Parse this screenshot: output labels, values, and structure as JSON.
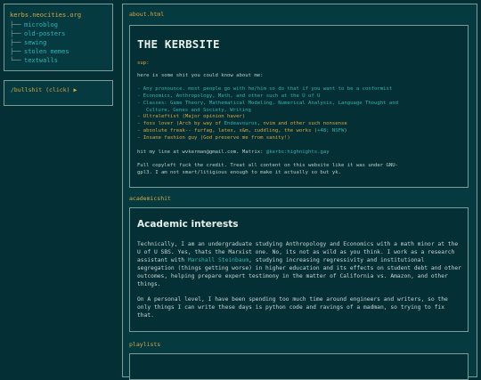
{
  "sidebar": {
    "site_title": "kerbs.neocities.org",
    "tree_branch": "├──",
    "tree_last": "└──",
    "items": [
      {
        "label": "microblog"
      },
      {
        "label": "old-posters"
      },
      {
        "label": "sewing"
      },
      {
        "label": "stolen memes"
      },
      {
        "label": "textwalls"
      }
    ],
    "bullshit_link": "/bullshit (click) ▶"
  },
  "about": {
    "section_label": "about.html",
    "title": "THE KERBSITE",
    "greeting": "sup:",
    "intro": "here is some shit you could know about me:",
    "list": [
      {
        "text": "- Any pronounce. most people go with he/him so do that if you want to be a conformist",
        "color": "teal"
      },
      {
        "text": "- Economics, Anthropology, Math, and other such at the U of U",
        "color": "teal"
      },
      {
        "text": "- Classes: Game Theory, Mathematical Modeling, Numerical Analysis, Language Thought and",
        "color": "teal"
      },
      {
        "text": "Culture, Genes and Society, Writing",
        "color": "teal",
        "indent": true
      },
      {
        "text": "- Ultraleftist (Major opinion haver)",
        "color": "orange"
      },
      {
        "text": "- foss lover (Arch by way of ",
        "color": "teal",
        "link": "Endeavouros",
        "rest": ", nvim and other such nonsense"
      },
      {
        "text": "- absolute freak-- furfag, latex, s&m, cuddling, the works (",
        "color": "teal",
        "link": "+48; NSFW",
        "rest": ")"
      },
      {
        "text": "- Insane fashion guy (God preserve me from sanity!)",
        "color": "orange"
      }
    ],
    "contact_prefix": "hit my line at ",
    "contact_email": "wvkerman@gmail.com",
    "contact_matrix_label": ". Matrix: ",
    "contact_matrix": "@kerbs:highnights.gay",
    "copyleft_line1": "Full copyleft fuck the credit. Treat all content on this website like it was under GNU-",
    "copyleft_line2": "gpl3. I am not smart/litigious enough to make it actually so but yk."
  },
  "academic": {
    "section_label": "academicshit",
    "title": "Academic interests",
    "para1_a": "Technically, I am an undergraduate studying Anthropology and Economics with a math minor at the U of U SBS. Yes, thats the Marxist one. No, its not as wild as you think. I work as a research assistant with ",
    "para1_link": "Marshall Steinbaum",
    "para1_b": ", studying increasing regressivity and institutional segregation (things getting worse) in higher education and its effects on student debt and other outcomes, helping prepare expert testimony in the matter of California vs. Amazon, and other things.",
    "para2": "On A personal level, I have been spending too much time around engineers and writers, so the only things I can write these days is python code and ravings of a madman, so trying to fix that."
  },
  "playlists": {
    "section_label": "playlists"
  },
  "colors": {
    "background": "#042f35",
    "panel": "#063a41",
    "border": "#7d9c98",
    "accent_orange": "#d9a83d",
    "accent_teal": "#2fb3b3"
  }
}
